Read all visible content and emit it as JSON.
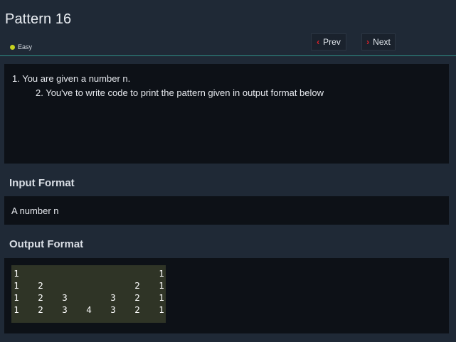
{
  "header": {
    "title": "Pattern 16",
    "difficulty": {
      "label": "Easy",
      "dot_color": "#c6d21f"
    },
    "nav": {
      "prev_label": "Prev",
      "next_label": "Next",
      "chevron_color": "#e2202a"
    }
  },
  "statement": {
    "line1": "1. You are given a number n.",
    "line2": "2. You've to write code to print the pattern given in output format below"
  },
  "input_format": {
    "heading": "Input Format",
    "text": "A number n"
  },
  "output_format": {
    "heading": "Output Format",
    "pattern_rows": [
      [
        "1",
        "",
        "",
        "",
        "",
        "",
        "1"
      ],
      [
        "1",
        "2",
        "",
        "",
        "",
        "2",
        "1"
      ],
      [
        "1",
        "2",
        "3",
        "",
        "3",
        "2",
        "1"
      ],
      [
        "1",
        "2",
        "3",
        "4",
        "3",
        "2",
        "1"
      ]
    ]
  }
}
